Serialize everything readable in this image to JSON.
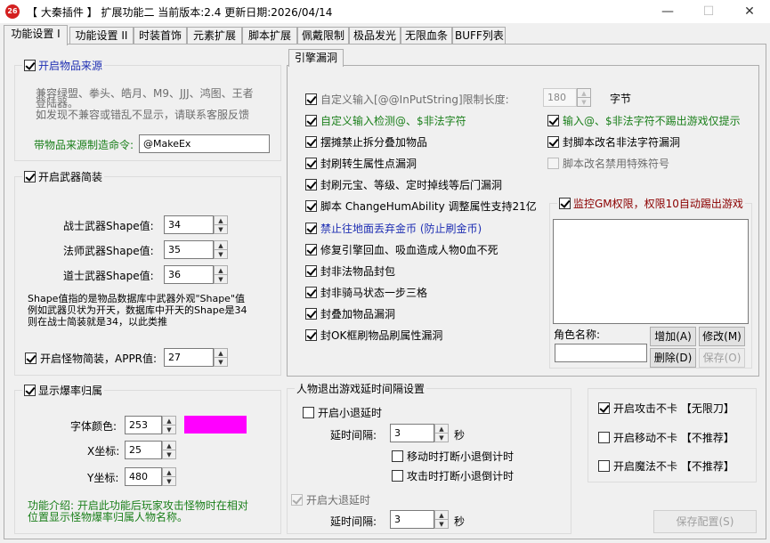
{
  "window": {
    "icon_text": "26",
    "title": "【 大秦插件 】 扩展功能二 当前版本:2.4 更新日期:2026/04/14",
    "minimize": "—",
    "maximize": "☐",
    "close": "✕"
  },
  "tabs": [
    {
      "label": "功能设置 I",
      "active": true
    },
    {
      "label": "功能设置 II"
    },
    {
      "label": "时装首饰"
    },
    {
      "label": "元素扩展"
    },
    {
      "label": "脚本扩展"
    },
    {
      "label": "佩戴限制"
    },
    {
      "label": "极品发光"
    },
    {
      "label": "无限血条"
    },
    {
      "label": "BUFF列表"
    }
  ],
  "item_source": {
    "title": "开启物品来源",
    "checked": true,
    "note_line1": "兼容绿盟、拳头、皓月、M9、JJJ、鸿图、王者",
    "note_line2": "登陆器。",
    "note_line3": "如发现不兼容或错乱不显示，请联系客服反馈",
    "cmd_label": "带物品来源制造命令:",
    "cmd_value": "@MakeEx"
  },
  "weapon_simple": {
    "title": "开启武器简装",
    "checked": true,
    "warrior_label": "战士武器Shape值:",
    "warrior_value": "34",
    "mage_label": "法师武器Shape值:",
    "mage_value": "35",
    "taoist_label": "道士武器Shape值:",
    "taoist_value": "36",
    "desc_line1": "Shape值指的是物品数据库中武器外观\"Shape\"值",
    "desc_line2": "例如武器贝状为开天，数据库中开天的Shape是34",
    "desc_line3": "则在战士简装就是34，以此类推",
    "monster_label": "开启怪物简装，APPR值:",
    "monster_checked": true,
    "monster_value": "27"
  },
  "drop_rate": {
    "title": "显示爆率归属",
    "checked": true,
    "font_color_label": "字体颜色:",
    "font_color_value": "253",
    "font_color_hex": "#ff00ff",
    "x_label": "X坐标:",
    "x_value": "25",
    "y_label": "Y坐标:",
    "y_value": "480",
    "intro_line1": "功能介绍: 开启此功能后玩家攻击怪物时在相对",
    "intro_line2": "位置显示怪物爆率归属人物名称。"
  },
  "engine": {
    "tab_label": "引擎漏洞",
    "left_items": [
      {
        "label": "自定义输入[@@InPutString]限制长度:",
        "checked": true,
        "style": "grey"
      },
      {
        "label": "自定义输入检测@、$非法字符",
        "checked": true,
        "style": "green"
      },
      {
        "label": "摆摊禁止拆分叠加物品",
        "checked": true,
        "style": "normal"
      },
      {
        "label": "封刷转生属性点漏洞",
        "checked": true,
        "style": "normal"
      },
      {
        "label": "封刷元宝、等级、定时掉线等后门漏洞",
        "checked": true,
        "style": "normal"
      },
      {
        "label": "脚本 ChangeHumAbility 调整属性支持21亿",
        "checked": true,
        "style": "normal"
      },
      {
        "label": "禁止往地面丢弃金币 (防止刷金币)",
        "checked": true,
        "style": "blue"
      },
      {
        "label": "修复引擎回血、吸血造成人物0血不死",
        "checked": true,
        "style": "normal"
      },
      {
        "label": "封非法物品封包",
        "checked": true,
        "style": "normal"
      },
      {
        "label": "封非骑马状态一步三格",
        "checked": true,
        "style": "normal"
      },
      {
        "label": "封叠加物品漏洞",
        "checked": true,
        "style": "normal"
      },
      {
        "label": "封OK框刷物品刷属性漏洞",
        "checked": true,
        "style": "normal"
      }
    ],
    "limit_value": "180",
    "limit_unit": "字节",
    "right_items": [
      {
        "label": "输入@、$非法字符不踢出游戏仅提示",
        "checked": true,
        "style": "green"
      },
      {
        "label": "封脚本改名非法字符漏洞",
        "checked": true,
        "style": "normal"
      },
      {
        "label": "脚本改名禁用特殊符号",
        "checked": false,
        "style": "grey"
      }
    ],
    "gm_monitor": {
      "title": "监控GM权限，权限10自动踢出游戏",
      "checked": true,
      "role_label": "角色名称:",
      "role_value": "",
      "add": "增加(A)",
      "modify": "修改(M)",
      "delete": "删除(D)",
      "save": "保存(O)"
    }
  },
  "exit_delay": {
    "title": "人物退出游戏延时间隔设置",
    "small_title": "开启小退延时",
    "small_checked": false,
    "small_interval_label": "延时间隔:",
    "small_interval_value": "3",
    "small_unit": "秒",
    "move_break": "移动时打断小退倒计时",
    "attack_break": "攻击时打断小退倒计时",
    "big_title": "开启大退延时",
    "big_checked": true,
    "big_interval_label": "延时间隔:",
    "big_interval_value": "3",
    "big_unit": "秒"
  },
  "no_lag": {
    "attack": "开启攻击不卡 【无限刀】",
    "attack_checked": true,
    "move": "开启移动不卡 【不推荐】",
    "move_checked": false,
    "magic": "开启魔法不卡 【不推荐】",
    "magic_checked": false
  },
  "save_button": "保存配置(S)"
}
